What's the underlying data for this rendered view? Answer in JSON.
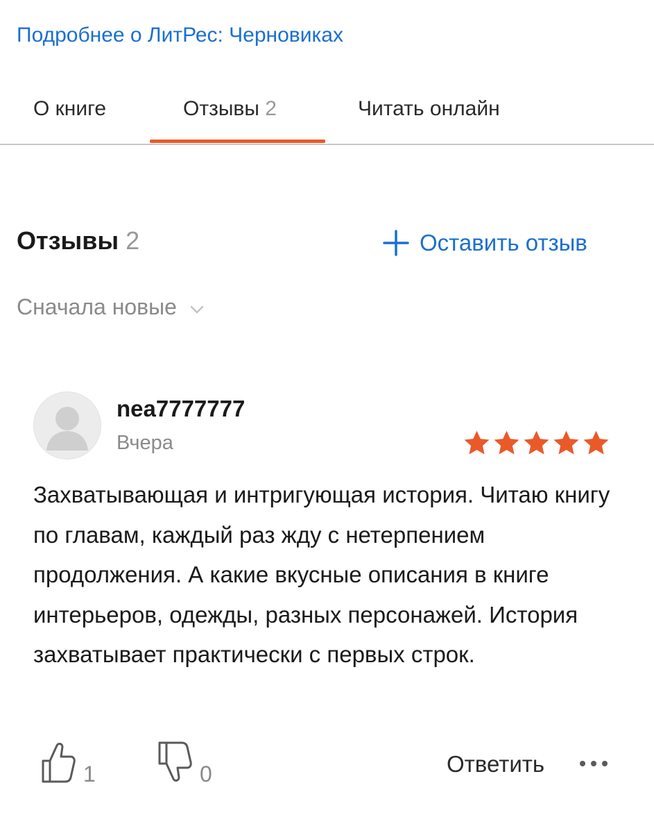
{
  "top_link": "Подробнее о ЛитРес: Черновиках",
  "tabs": [
    {
      "label": "О книге",
      "count": ""
    },
    {
      "label": "Отзывы",
      "count": "2"
    },
    {
      "label": "Читать онлайн",
      "count": ""
    }
  ],
  "active_tab": "Отзывы",
  "reviews_section": {
    "title": "Отзывы",
    "count": "2",
    "add_review_label": "Оставить отзыв",
    "sort_label": "Сначала новые"
  },
  "review": {
    "username": "nea7777777",
    "date": "Вчера",
    "rating": 5,
    "text": "Захватывающая и интригующая история. Читаю книгу по главам, каждый раз жду с нетерпением продолжения. А какие вкусные описания в книге интерьеров, одежды, разных персонажей. История захватывает практически с первых строк.",
    "likes": "1",
    "dislikes": "0",
    "reply_label": "Ответить"
  },
  "icons": {
    "add": "plus-icon",
    "sort": "chevron-down-icon",
    "avatar": "user-silhouette-icon",
    "star": "star-icon",
    "like": "thumbs-up-icon",
    "dislike": "thumbs-down-icon",
    "more": "more-dots-icon"
  },
  "colors": {
    "accent_blue": "#1a6fd0",
    "accent_orange": "#ea5a29",
    "muted_text": "#8a8a8a"
  }
}
